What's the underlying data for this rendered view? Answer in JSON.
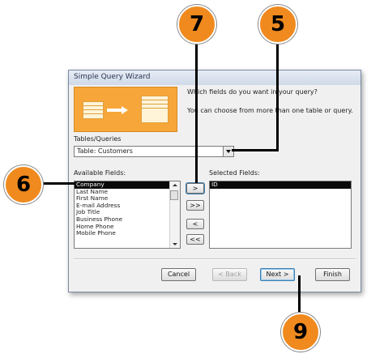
{
  "dialog": {
    "title": "Simple Query Wizard",
    "prompt_line1": "Which fields do you want in your query?",
    "prompt_line2": "You can choose from more than one table or query.",
    "tables_label": "Tables/Queries",
    "tables_value": "Table: Customers",
    "available_label": "Available Fields:",
    "selected_label": "Selected Fields:",
    "available_fields": [
      "Company",
      "Last Name",
      "First Name",
      "E-mail Address",
      "Job Title",
      "Business Phone",
      "Home Phone",
      "Mobile Phone"
    ],
    "selected_fields": [
      "ID"
    ],
    "move_buttons": {
      "add": ">",
      "add_all": ">>",
      "remove": "<",
      "remove_all": "<<"
    },
    "buttons": {
      "cancel": "Cancel",
      "back": "< Back",
      "next": "Next >",
      "finish": "Finish"
    }
  },
  "callouts": {
    "c7": "7",
    "c5": "5",
    "c6": "6",
    "c9": "9"
  },
  "colors": {
    "callout": "#f08a1e",
    "highlight": "#0a0a0a",
    "banner": "#f7a63a"
  }
}
